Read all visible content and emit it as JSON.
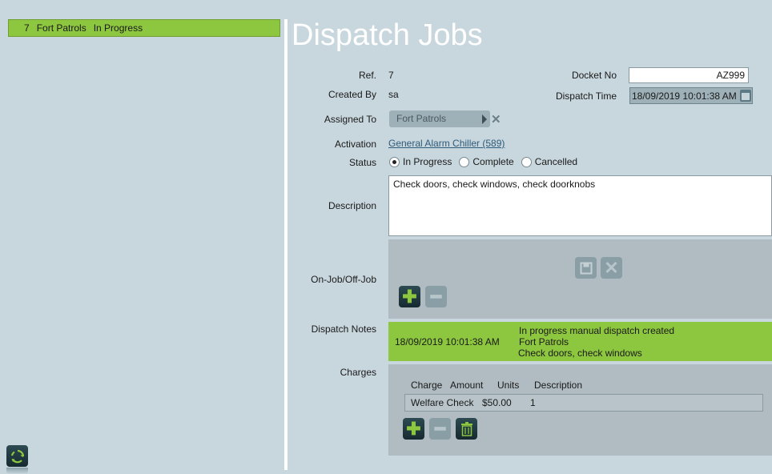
{
  "jobs_list": [
    {
      "ref": "7",
      "name": "Fort Patrols",
      "status": "In Progress"
    }
  ],
  "page_title": "Dispatch Jobs",
  "form": {
    "ref_label": "Ref.",
    "ref_value": "7",
    "created_by_label": "Created By",
    "created_by_value": "sa",
    "assigned_to_label": "Assigned To",
    "assigned_to_value": "Fort Patrols",
    "activation_label": "Activation",
    "activation_value": "General Alarm Chiller (589)",
    "status_label": "Status",
    "status_options": [
      "In Progress",
      "Complete",
      "Cancelled"
    ],
    "status_selected": "In Progress",
    "description_label": "Description",
    "description_value": "Check doors, check windows, check doorknobs",
    "docket_label": "Docket No",
    "docket_value": "AZ999",
    "dispatch_time_label": "Dispatch Time",
    "dispatch_time_value": "18/09/2019 10:01:38 AM",
    "onjob_label": "On-Job/Off-Job",
    "dispatch_notes_label": "Dispatch Notes",
    "charges_label": "Charges"
  },
  "dispatch_notes": {
    "timestamp": "18/09/2019 10:01:38 AM",
    "line1": "In progress manual dispatch created",
    "line2": "Fort Patrols",
    "line3": "Check doors, check windows"
  },
  "charges": {
    "headers": [
      "Charge",
      "Amount",
      "Units",
      "Description"
    ],
    "rows": [
      {
        "charge": "Welfare Check",
        "amount": "$50.00",
        "units": "1",
        "description": ""
      }
    ]
  },
  "colors": {
    "background": "#c8d6dd",
    "accent_green": "#8dc63f",
    "panel": "#b0bcc1",
    "dark_button": "#1e363d"
  },
  "icons": {
    "refresh": "refresh-icon",
    "save": "save-icon",
    "cancel": "cancel-icon",
    "add": "plus-icon",
    "remove": "minus-icon",
    "delete": "trash-icon",
    "calendar": "calendar-icon",
    "clear": "close-icon"
  }
}
